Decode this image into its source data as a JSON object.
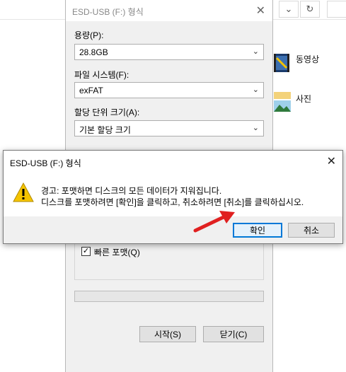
{
  "explorer": {
    "folders": [
      {
        "label": "동영상"
      },
      {
        "label": "사진"
      }
    ]
  },
  "format_dialog": {
    "title": "ESD-USB (F:) 형식",
    "capacity": {
      "label": "용량(P):",
      "value": "28.8GB"
    },
    "filesystem": {
      "label": "파일 시스템(F):",
      "value": "exFAT"
    },
    "allocation": {
      "label": "할당 단위 크기(A):",
      "value": "기본 할당 크기"
    },
    "quick_format": {
      "label": "빠른 포맷(Q)",
      "checked": true
    },
    "start_label": "시작(S)",
    "close_label": "닫기(C)"
  },
  "warning_dialog": {
    "title": "ESD-USB (F:) 형식",
    "line1": "경고: 포맷하면 디스크의 모든 데이터가 지워집니다.",
    "line2": "디스크를 포맷하려면 [확인]을 클릭하고, 취소하려면 [취소]를 클릭하십시오.",
    "ok_label": "확인",
    "cancel_label": "취소"
  },
  "colors": {
    "accent": "#0078d7",
    "annotation_arrow": "#e02020",
    "warning": "#f5c400"
  },
  "icons": [
    "chevron-down-icon",
    "refresh-icon",
    "close-icon",
    "warning-icon",
    "folder-icon"
  ]
}
